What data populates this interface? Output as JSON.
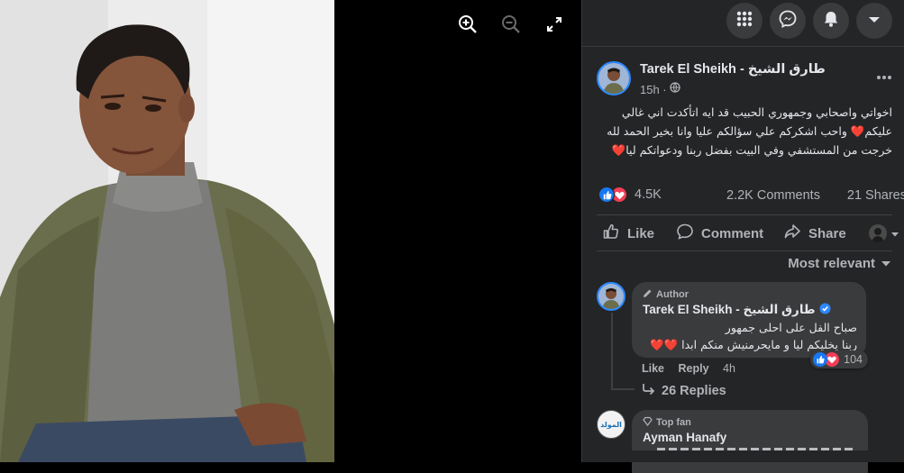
{
  "viewer": {
    "zoom_in_icon": "zoom-in-icon",
    "zoom_out_icon": "zoom-out-icon",
    "fullscreen_icon": "fullscreen-icon"
  },
  "topbar": {
    "menu_icon": "grid-menu-icon",
    "messenger_icon": "messenger-icon",
    "notifications_icon": "bell-icon",
    "account_icon": "caret-down-icon"
  },
  "post": {
    "author": "Tarek El Sheikh - طارق الشيخ",
    "time": "15h ·",
    "text_line1": "اخواتي واصحابي وجمهوري الحبيب قد ايه اتأكدت اني غالي",
    "text_line2": "عليكم❤️ واحب اشكركم علي سؤالكم عليا وانا بخير الحمد لله",
    "text_line3": "خرجت من المستشفي وفي البيت بفضل ربنا ودعواتكم ليا❤️",
    "reactions_count": "4.5K",
    "comments_count": "2.2K Comments",
    "shares_count": "21 Shares",
    "colors": {
      "like_blue": "#1877f2",
      "love_red": "#f33e58",
      "panel_bg": "#242526",
      "bubble_bg": "#3a3b3c"
    }
  },
  "actions": {
    "like": "Like",
    "comment": "Comment",
    "share": "Share"
  },
  "sort_label": "Most relevant",
  "comments": [
    {
      "badge": "Author",
      "name": "Tarek El Sheikh - طارق الشيخ",
      "line1": "صباح الفل على احلى جمهور",
      "line2": "ربنا يخليكم ليا و مايحرمنيش منكم ابدا ❤️❤️",
      "like": "Like",
      "reply": "Reply",
      "time": "4h",
      "reactions": "104",
      "replies": "26 Replies"
    },
    {
      "badge": "Top fan",
      "name": "Ayman Hanafy",
      "avatar_text": "المولد"
    }
  ]
}
